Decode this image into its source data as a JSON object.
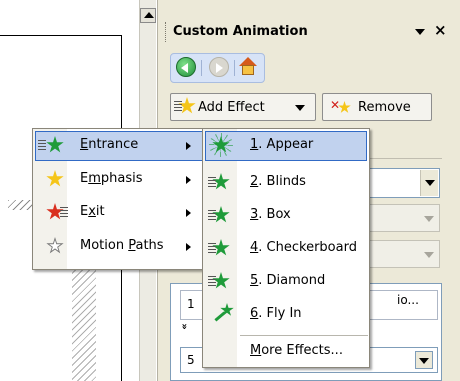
{
  "pane": {
    "title": "Custom Animation",
    "close_glyph": "×",
    "add_effect_label": "Add Effect",
    "remove_label": "Remove",
    "list_item_number": "1",
    "list_item_text": "io...",
    "sub_item_number": "5",
    "expand_glyph": "»"
  },
  "menu": {
    "items": [
      {
        "pre": "",
        "key": "E",
        "post": "ntrance",
        "icon": "entrance-star-icon",
        "highlighted": true
      },
      {
        "pre": "E",
        "key": "m",
        "post": "phasis",
        "icon": "emphasis-star-icon",
        "highlighted": false
      },
      {
        "pre": "E",
        "key": "x",
        "post": "it",
        "icon": "exit-star-icon",
        "highlighted": false
      },
      {
        "pre": "Motion ",
        "key": "P",
        "post": "aths",
        "icon": "motion-paths-icon",
        "highlighted": false
      }
    ]
  },
  "submenu": {
    "items": [
      {
        "key": "1",
        "post": ". Appear",
        "highlighted": true
      },
      {
        "key": "2",
        "post": ". Blinds",
        "highlighted": false
      },
      {
        "key": "3",
        "post": ". Box",
        "highlighted": false
      },
      {
        "key": "4",
        "post": ". Checkerboard",
        "highlighted": false
      },
      {
        "key": "5",
        "post": ". Diamond",
        "highlighted": false
      },
      {
        "key": "6",
        "post": ". Fly In",
        "highlighted": false
      }
    ],
    "more": {
      "key": "M",
      "post": "ore Effects..."
    }
  },
  "colors": {
    "highlight_bg": "#c1d2ee",
    "highlight_border": "#316ac5",
    "pane_bg": "#ece9d8",
    "star_green": "#1f9b3a"
  }
}
